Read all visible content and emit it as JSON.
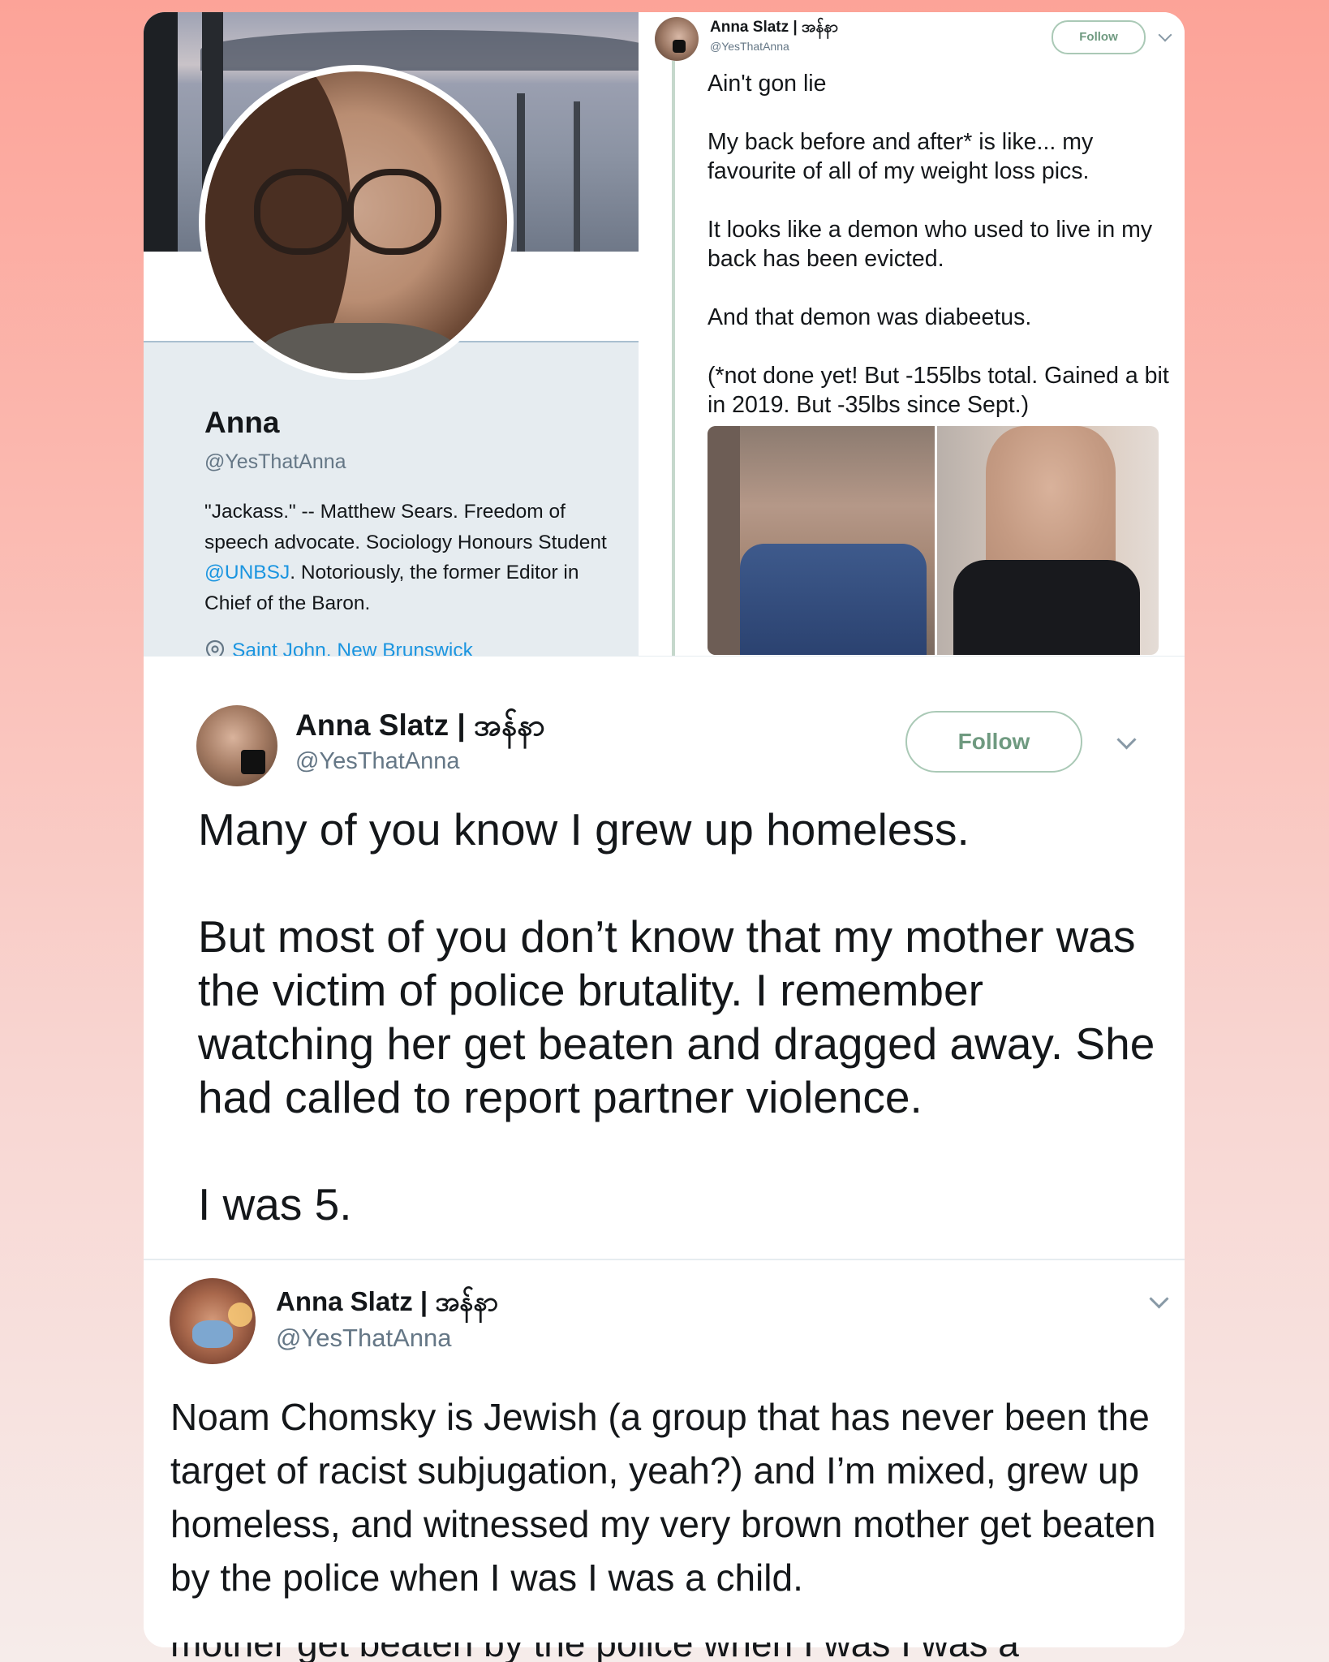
{
  "profile": {
    "name": "Anna",
    "handle": "@YesThatAnna",
    "bio_pre": "\"Jackass.\" -- Matthew Sears. Freedom of speech advocate. Sociology Honours Student ",
    "bio_link": "@UNBSJ",
    "bio_post": ". Notoriously, the former Editor in Chief of the Baron.",
    "location": "Saint John, New Brunswick"
  },
  "tweet1": {
    "name": "Anna Slatz | အန်နာ",
    "handle": "@YesThatAnna",
    "follow_label": "Follow",
    "text": "Ain't gon lie\n\nMy back before and after* is like... my favourite of all of my weight loss pics.\n\nIt looks like a demon who used to live in my back has been evicted.\n\nAnd that demon was diabeetus.\n\n(*not done yet! But -155lbs total. Gained a bit in 2019. But -35lbs since Sept.)"
  },
  "tweet2": {
    "name": "Anna Slatz | အန်နာ",
    "handle": "@YesThatAnna",
    "follow_label": "Follow",
    "text": "Many of you know I grew up homeless.\n\nBut most of you don’t know that my mother was the victim of police brutality. I remember watching her get beaten and dragged away. She had called to report partner violence.\n\nI was 5."
  },
  "tweet3": {
    "name": "Anna Slatz | အန်နာ",
    "handle": "@YesThatAnna",
    "text": "Noam Chomsky is Jewish (a group that has never been the target of racist subjugation, yeah?) and I’m mixed, grew up homeless, and witnessed my very brown mother get beaten by the police when I was I was a child.",
    "cutoff_text": "mother get beaten by the police when I was I was a"
  }
}
